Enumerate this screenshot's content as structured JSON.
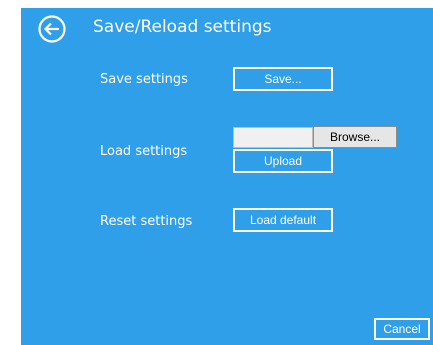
{
  "header": {
    "title": "Save/Reload settings",
    "back_icon": "back-arrow-circle-icon"
  },
  "save": {
    "label": "Save settings",
    "button": "Save..."
  },
  "load": {
    "label": "Load settings",
    "file_value": "",
    "browse_button": "Browse...",
    "upload_button": "Upload"
  },
  "reset": {
    "label": "Reset settings",
    "button": "Load default"
  },
  "footer": {
    "cancel_button": "Cancel"
  },
  "colors": {
    "panel": "#2e9fe8",
    "text": "#ffffff"
  }
}
